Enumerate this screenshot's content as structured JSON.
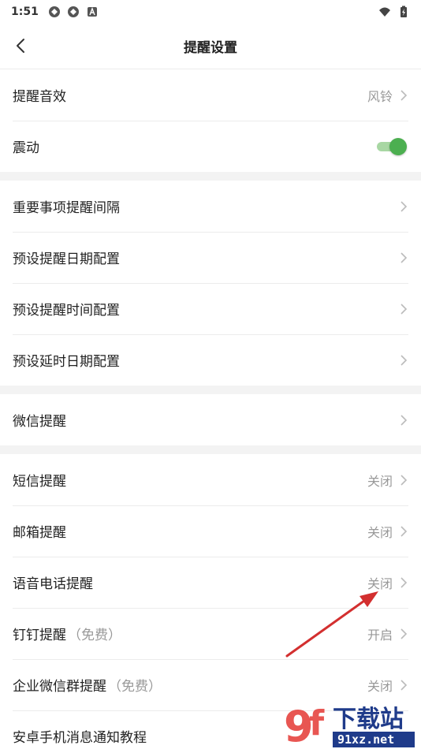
{
  "status": {
    "time": "1:51"
  },
  "header": {
    "title": "提醒设置"
  },
  "group1": [
    {
      "label": "提醒音效",
      "value": "风铃"
    },
    {
      "label": "震动"
    }
  ],
  "group2": [
    {
      "label": "重要事项提醒间隔"
    },
    {
      "label": "预设提醒日期配置"
    },
    {
      "label": "预设提醒时间配置"
    },
    {
      "label": "预设延时日期配置"
    }
  ],
  "group3": [
    {
      "label": "微信提醒"
    }
  ],
  "group4": [
    {
      "label": "短信提醒",
      "value": "关闭"
    },
    {
      "label": "邮箱提醒",
      "value": "关闭"
    },
    {
      "label": "语音电话提醒",
      "value": "关闭"
    },
    {
      "label": "钉钉提醒",
      "note": "（免费）",
      "value": "开启"
    },
    {
      "label": "企业微信群提醒",
      "note": "（免费）",
      "value": "关闭"
    },
    {
      "label": "安卓手机消息通知教程"
    }
  ],
  "vibration_on": true,
  "colors": {
    "toggle": "#4caf50",
    "annotation_arrow": "#d32f2f"
  },
  "watermark": {
    "brand": "下载站",
    "domain": "91xz.net"
  }
}
